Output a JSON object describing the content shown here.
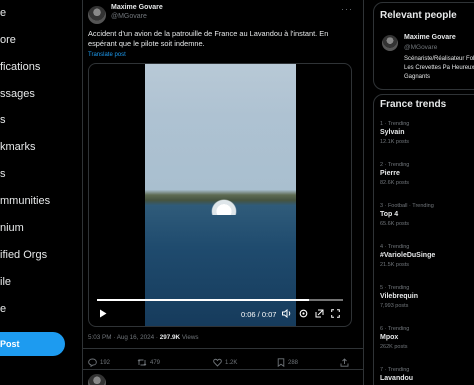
{
  "nav": {
    "items": [
      "e",
      "ore",
      "fications",
      "ssages",
      "s",
      "kmarks",
      "s",
      "mmunities",
      "nium",
      "ified Orgs",
      "ile",
      "e"
    ],
    "post_label": "Post"
  },
  "tweet": {
    "author_name": "Maxime Govare",
    "author_handle": "@MGovare",
    "text": "Accident d'un avion de la patrouille de France au Lavandou à l'instant. En espérant que le pilote soit indemne.",
    "translate_label": "Translate post",
    "video": {
      "time": "0:06 / 0:07",
      "progress": 0.86
    },
    "time": "5:03 PM · Aug 16, 2024 · ",
    "views": "297.9K",
    "views_label": " Views",
    "stats": {
      "replies": "192",
      "reposts": "479",
      "likes": "1.2K",
      "bookmarks": "288"
    }
  },
  "relevant": {
    "title": "Relevant people",
    "name": "Maxime Govare",
    "handle": "@MGovare",
    "bio": "Scénariste/Réalisateur Fols - Les Crevettes Pa Heureux Gagnants"
  },
  "trends": {
    "title": "France trends",
    "items": [
      {
        "meta": "1 · Trending",
        "name": "Sylvain",
        "count": "12.1K posts"
      },
      {
        "meta": "2 · Trending",
        "name": "Pierre",
        "count": "82.6K posts"
      },
      {
        "meta": "3 · Football · Trending",
        "name": "Top 4",
        "count": "65.6K posts"
      },
      {
        "meta": "4 · Trending",
        "name": "#VarioleDuSinge",
        "count": "21.5K posts"
      },
      {
        "meta": "5 · Trending",
        "name": "Vilebrequin",
        "count": "7,993 posts"
      },
      {
        "meta": "6 · Trending",
        "name": "Mpox",
        "count": "262K posts"
      },
      {
        "meta": "7 · Trending",
        "name": "Lavandou",
        "count": ""
      }
    ]
  },
  "colors": {
    "accent": "#1d9bf0",
    "background": "#000000",
    "muted": "#71767b",
    "border": "#2f3336"
  }
}
